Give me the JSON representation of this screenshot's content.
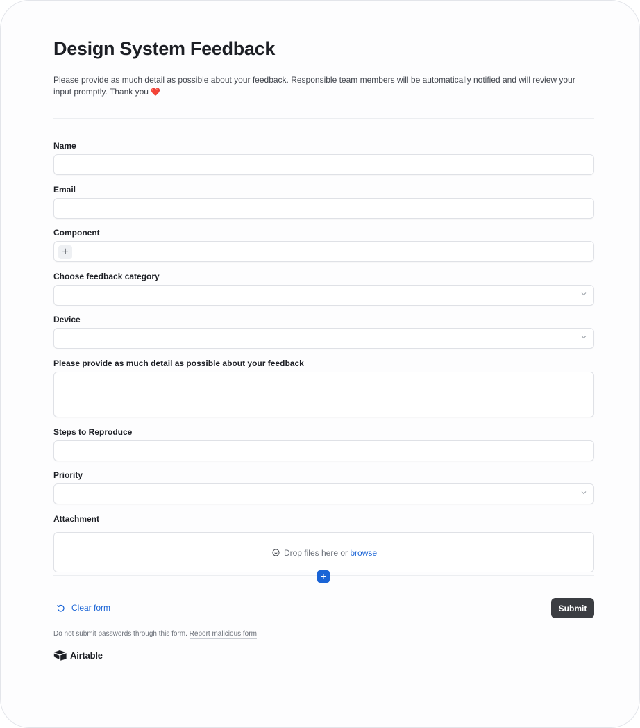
{
  "form": {
    "title": "Design System Feedback",
    "description": "Please provide as much detail as possible about your feedback. Responsible team members will be automatically notified and will review your input promptly. Thank you",
    "description_emoji": "❤️",
    "fields": {
      "name": {
        "label": "Name",
        "value": ""
      },
      "email": {
        "label": "Email",
        "value": ""
      },
      "component": {
        "label": "Component",
        "add_symbol": "+"
      },
      "category": {
        "label": "Choose feedback category",
        "selected": ""
      },
      "device": {
        "label": "Device",
        "selected": ""
      },
      "detail": {
        "label": "Please provide as much detail as possible about your feedback",
        "value": ""
      },
      "steps": {
        "label": "Steps to Reproduce",
        "value": ""
      },
      "priority": {
        "label": "Priority",
        "selected": ""
      },
      "attachment": {
        "label": "Attachment",
        "drop_text": "Drop files here or",
        "browse_text": "browse",
        "add_symbol": "+"
      }
    },
    "actions": {
      "clear_label": "Clear form",
      "submit_label": "Submit"
    },
    "footer": {
      "note": "Do not submit passwords through this form.",
      "report_link": "Report malicious form",
      "brand": "Airtable"
    }
  },
  "colors": {
    "accent": "#1a64d6",
    "submit_bg": "#3b3d42",
    "heart": "#d9232d"
  },
  "icons": [
    "plus-icon",
    "chevron-down-icon",
    "download-circle-icon",
    "undo-icon",
    "airtable-logo-icon"
  ]
}
